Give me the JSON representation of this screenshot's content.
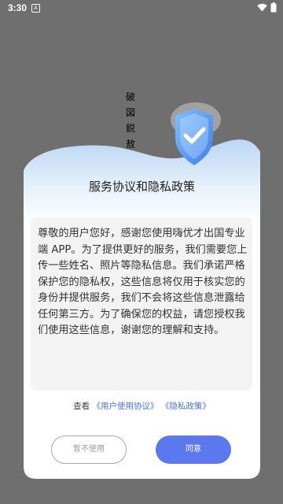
{
  "status_bar": {
    "time": "3:30",
    "notification": "A"
  },
  "background": {
    "vertical_text": "破 図 鋭 敖"
  },
  "dialog": {
    "title": "服务协议和隐私政策",
    "body": "尊敬的用户您好，感谢您使用嗨优才出国专业端 APP。为了提供更好的服务，我们需要您上传一些姓名、照片等隐私信息。我们承诺严格保护您的隐私权，这些信息将仅用于核实您的身份并提供服务，我们不会将这些信息泄露给任何第三方。为了确保您的权益，请您授权我们使用这些信息，谢谢您的理解和支持。",
    "links_prefix": "查看",
    "user_agreement_link": "《用户使用协议》",
    "privacy_policy_link": "《隐私政策》",
    "decline_label": "暂不使用",
    "agree_label": "同意"
  },
  "colors": {
    "accent": "#5b78ef",
    "link": "#4a6cf0",
    "overlay": "#6f6f6f",
    "shield": "#4a8ff0"
  }
}
